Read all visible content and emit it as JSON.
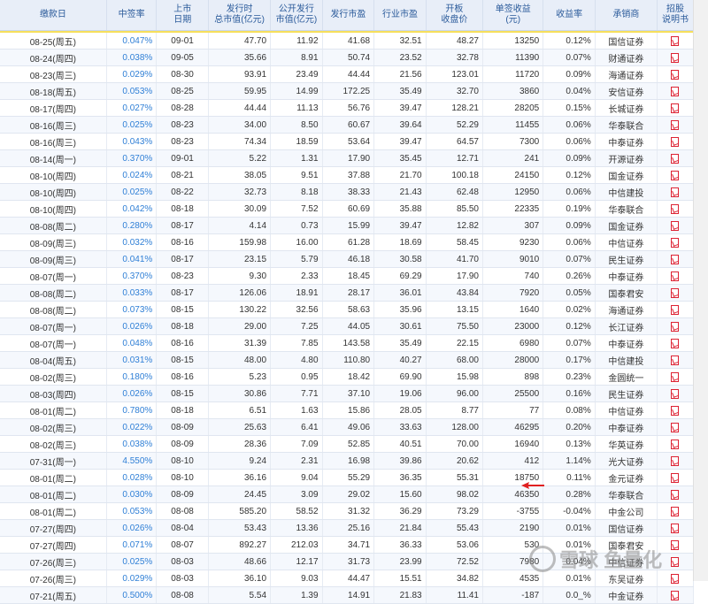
{
  "headers": [
    "缴款日",
    "中签率",
    "上市\n日期",
    "发行时\n总市值(亿元)",
    "公开发行\n市值(亿元)",
    "发行市盈",
    "行业市盈",
    "开板\n收盘价",
    "单签收益\n(元)",
    "收益率",
    "承销商",
    "招股\n说明书"
  ],
  "rows": [
    {
      "date": "08-25(周五)",
      "rate": "0.047%",
      "list": "09-01",
      "total": "47.70",
      "pub": "11.92",
      "pe": "41.68",
      "ipe": "32.51",
      "close": "48.27",
      "gain": "13250",
      "ret": "0.12%",
      "under": "国信证券"
    },
    {
      "date": "08-24(周四)",
      "rate": "0.038%",
      "list": "09-05",
      "total": "35.66",
      "pub": "8.91",
      "pe": "50.74",
      "ipe": "23.52",
      "close": "32.78",
      "gain": "11390",
      "ret": "0.07%",
      "under": "财通证券"
    },
    {
      "date": "08-23(周三)",
      "rate": "0.029%",
      "list": "08-30",
      "total": "93.91",
      "pub": "23.49",
      "pe": "44.44",
      "ipe": "21.56",
      "close": "123.01",
      "gain": "11720",
      "ret": "0.09%",
      "under": "海通证券"
    },
    {
      "date": "08-18(周五)",
      "rate": "0.053%",
      "list": "08-25",
      "total": "59.95",
      "pub": "14.99",
      "pe": "172.25",
      "ipe": "35.49",
      "close": "32.70",
      "gain": "3860",
      "ret": "0.04%",
      "under": "安信证券"
    },
    {
      "date": "08-17(周四)",
      "rate": "0.027%",
      "list": "08-28",
      "total": "44.44",
      "pub": "11.13",
      "pe": "56.76",
      "ipe": "39.47",
      "close": "128.21",
      "gain": "28205",
      "ret": "0.15%",
      "under": "长城证券"
    },
    {
      "date": "08-16(周三)",
      "rate": "0.025%",
      "list": "08-23",
      "total": "34.00",
      "pub": "8.50",
      "pe": "60.67",
      "ipe": "39.64",
      "close": "52.29",
      "gain": "11455",
      "ret": "0.06%",
      "under": "华泰联合"
    },
    {
      "date": "08-16(周三)",
      "rate": "0.043%",
      "list": "08-23",
      "total": "74.34",
      "pub": "18.59",
      "pe": "53.64",
      "ipe": "39.47",
      "close": "64.57",
      "gain": "7300",
      "ret": "0.06%",
      "under": "中泰证券"
    },
    {
      "date": "08-14(周一)",
      "rate": "0.370%",
      "list": "09-01",
      "total": "5.22",
      "pub": "1.31",
      "pe": "17.90",
      "ipe": "35.45",
      "close": "12.71",
      "gain": "241",
      "ret": "0.09%",
      "under": "开源证券"
    },
    {
      "date": "08-10(周四)",
      "rate": "0.024%",
      "list": "08-21",
      "total": "38.05",
      "pub": "9.51",
      "pe": "37.88",
      "ipe": "21.70",
      "close": "100.18",
      "gain": "24150",
      "ret": "0.12%",
      "under": "国金证券"
    },
    {
      "date": "08-10(周四)",
      "rate": "0.025%",
      "list": "08-22",
      "total": "32.73",
      "pub": "8.18",
      "pe": "38.33",
      "ipe": "21.43",
      "close": "62.48",
      "gain": "12950",
      "ret": "0.06%",
      "under": "中信建投"
    },
    {
      "date": "08-10(周四)",
      "rate": "0.042%",
      "list": "08-18",
      "total": "30.09",
      "pub": "7.52",
      "pe": "60.69",
      "ipe": "35.88",
      "close": "85.50",
      "gain": "22335",
      "ret": "0.19%",
      "under": "华泰联合"
    },
    {
      "date": "08-08(周二)",
      "rate": "0.280%",
      "list": "08-17",
      "total": "4.14",
      "pub": "0.73",
      "pe": "15.99",
      "ipe": "39.47",
      "close": "12.82",
      "gain": "307",
      "ret": "0.09%",
      "under": "国金证券"
    },
    {
      "date": "08-09(周三)",
      "rate": "0.032%",
      "list": "08-16",
      "total": "159.98",
      "pub": "16.00",
      "pe": "61.28",
      "ipe": "18.69",
      "close": "58.45",
      "gain": "9230",
      "ret": "0.06%",
      "under": "中信证券"
    },
    {
      "date": "08-09(周三)",
      "rate": "0.041%",
      "list": "08-17",
      "total": "23.15",
      "pub": "5.79",
      "pe": "46.18",
      "ipe": "30.58",
      "close": "41.70",
      "gain": "9010",
      "ret": "0.07%",
      "under": "民生证券"
    },
    {
      "date": "08-07(周一)",
      "rate": "0.370%",
      "list": "08-23",
      "total": "9.30",
      "pub": "2.33",
      "pe": "18.45",
      "ipe": "69.29",
      "close": "17.90",
      "gain": "740",
      "ret": "0.26%",
      "under": "中泰证券"
    },
    {
      "date": "08-08(周二)",
      "rate": "0.033%",
      "list": "08-17",
      "total": "126.06",
      "pub": "18.91",
      "pe": "28.17",
      "ipe": "36.01",
      "close": "43.84",
      "gain": "7920",
      "ret": "0.05%",
      "under": "国泰君安"
    },
    {
      "date": "08-08(周二)",
      "rate": "0.073%",
      "list": "08-15",
      "total": "130.22",
      "pub": "32.56",
      "pe": "58.63",
      "ipe": "35.96",
      "close": "13.15",
      "gain": "1640",
      "ret": "0.02%",
      "under": "海通证券"
    },
    {
      "date": "08-07(周一)",
      "rate": "0.026%",
      "list": "08-18",
      "total": "29.00",
      "pub": "7.25",
      "pe": "44.05",
      "ipe": "30.61",
      "close": "75.50",
      "gain": "23000",
      "ret": "0.12%",
      "under": "长江证券"
    },
    {
      "date": "08-07(周一)",
      "rate": "0.048%",
      "list": "08-16",
      "total": "31.39",
      "pub": "7.85",
      "pe": "143.58",
      "ipe": "35.49",
      "close": "22.15",
      "gain": "6980",
      "ret": "0.07%",
      "under": "中泰证券"
    },
    {
      "date": "08-04(周五)",
      "rate": "0.031%",
      "list": "08-15",
      "total": "48.00",
      "pub": "4.80",
      "pe": "110.80",
      "ipe": "40.27",
      "close": "68.00",
      "gain": "28000",
      "ret": "0.17%",
      "under": "中信建投"
    },
    {
      "date": "08-02(周三)",
      "rate": "0.180%",
      "list": "08-16",
      "total": "5.23",
      "pub": "0.95",
      "pe": "18.42",
      "ipe": "69.90",
      "close": "15.98",
      "gain": "898",
      "ret": "0.23%",
      "under": "金圆统一"
    },
    {
      "date": "08-03(周四)",
      "rate": "0.026%",
      "list": "08-15",
      "total": "30.86",
      "pub": "7.71",
      "pe": "37.10",
      "ipe": "19.06",
      "close": "96.00",
      "gain": "25500",
      "ret": "0.16%",
      "under": "民生证券"
    },
    {
      "date": "08-01(周二)",
      "rate": "0.780%",
      "list": "08-18",
      "total": "6.51",
      "pub": "1.63",
      "pe": "15.86",
      "ipe": "28.05",
      "close": "8.77",
      "gain": "77",
      "ret": "0.08%",
      "under": "中信证券"
    },
    {
      "date": "08-02(周三)",
      "rate": "0.022%",
      "list": "08-09",
      "total": "25.63",
      "pub": "6.41",
      "pe": "49.06",
      "ipe": "33.63",
      "close": "128.00",
      "gain": "46295",
      "ret": "0.20%",
      "under": "中泰证券"
    },
    {
      "date": "08-02(周三)",
      "rate": "0.038%",
      "list": "08-09",
      "total": "28.36",
      "pub": "7.09",
      "pe": "52.85",
      "ipe": "40.51",
      "close": "70.00",
      "gain": "16940",
      "ret": "0.13%",
      "under": "华英证券"
    },
    {
      "date": "07-31(周一)",
      "rate": "4.550%",
      "list": "08-10",
      "total": "9.24",
      "pub": "2.31",
      "pe": "16.98",
      "ipe": "39.86",
      "close": "20.62",
      "gain": "412",
      "ret": "1.14%",
      "under": "光大证券"
    },
    {
      "date": "08-01(周二)",
      "rate": "0.028%",
      "list": "08-10",
      "total": "36.16",
      "pub": "9.04",
      "pe": "55.29",
      "ipe": "36.35",
      "close": "55.31",
      "gain": "18750",
      "ret": "0.11%",
      "under": "金元证券"
    },
    {
      "date": "08-01(周二)",
      "rate": "0.030%",
      "list": "08-09",
      "total": "24.45",
      "pub": "3.09",
      "pe": "29.02",
      "ipe": "15.60",
      "close": "98.02",
      "gain": "46350",
      "ret": "0.28%",
      "under": "华泰联合"
    },
    {
      "date": "08-01(周二)",
      "rate": "0.053%",
      "list": "08-08",
      "total": "585.20",
      "pub": "58.52",
      "pe": "31.32",
      "ipe": "36.29",
      "close": "73.29",
      "gain": "-3755",
      "ret": "-0.04%",
      "under": "中金公司"
    },
    {
      "date": "07-27(周四)",
      "rate": "0.026%",
      "list": "08-04",
      "total": "53.43",
      "pub": "13.36",
      "pe": "25.16",
      "ipe": "21.84",
      "close": "55.43",
      "gain": "2190",
      "ret": "0.01%",
      "under": "国信证券"
    },
    {
      "date": "07-27(周四)",
      "rate": "0.071%",
      "list": "08-07",
      "total": "892.27",
      "pub": "212.03",
      "pe": "34.71",
      "ipe": "36.33",
      "close": "53.06",
      "gain": "530",
      "ret": "0.01%",
      "under": "国泰君安"
    },
    {
      "date": "07-26(周三)",
      "rate": "0.025%",
      "list": "08-03",
      "total": "48.66",
      "pub": "12.17",
      "pe": "31.73",
      "ipe": "23.99",
      "close": "72.52",
      "gain": "7980",
      "ret": "0.04%",
      "under": "中信证券"
    },
    {
      "date": "07-26(周三)",
      "rate": "0.029%",
      "list": "08-03",
      "total": "36.10",
      "pub": "9.03",
      "pe": "44.47",
      "ipe": "15.51",
      "close": "34.82",
      "gain": "4535",
      "ret": "0.01%",
      "under": "东吴证券"
    },
    {
      "date": "07-21(周五)",
      "rate": "0.500%",
      "list": "08-08",
      "total": "5.54",
      "pub": "1.39",
      "pe": "14.91",
      "ipe": "21.83",
      "close": "11.41",
      "gain": "-187",
      "ret": "0.0_%",
      "under": "中金证券"
    }
  ],
  "watermark_text": "雪球 鱼量化",
  "colors": {
    "rate_blue": "#2f7fd6",
    "pdf_red": "#dd2222",
    "arrow_red": "#e02020",
    "header_blue": "#2a5a9a"
  }
}
